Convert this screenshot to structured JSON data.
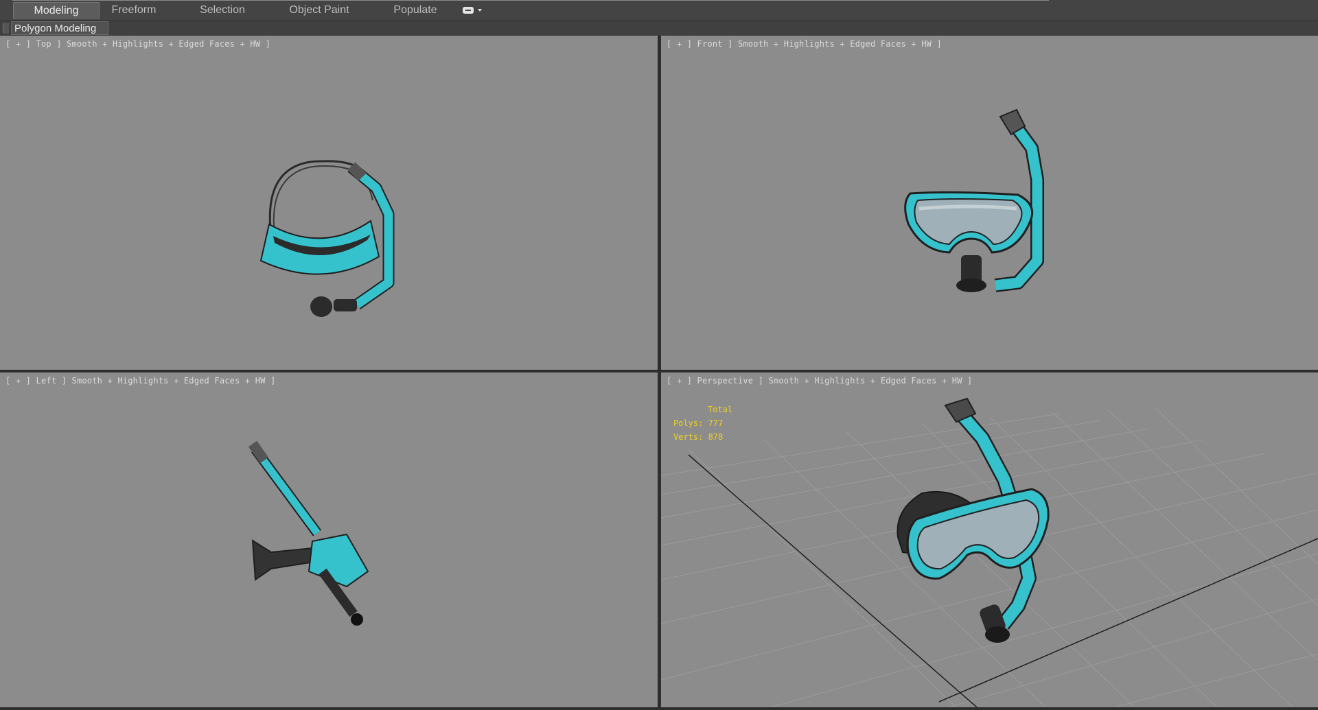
{
  "ribbon": {
    "tabs": [
      {
        "label": "Modeling",
        "active": true
      },
      {
        "label": "Freeform",
        "active": false
      },
      {
        "label": "Selection",
        "active": false
      },
      {
        "label": "Object Paint",
        "active": false
      },
      {
        "label": "Populate",
        "active": false
      }
    ],
    "panel_label": "Polygon Modeling"
  },
  "viewports": {
    "top": {
      "label": "[ + ] Top ] Smooth + Highlights + Edged Faces + HW ]"
    },
    "front": {
      "label": "[ + ] Front ] Smooth + Highlights + Edged Faces + HW ]"
    },
    "left": {
      "label": "[ + ] Left ] Smooth + Highlights + Edged Faces + HW ]"
    },
    "perspective": {
      "label": "[ + ] Perspective ] Smooth + Highlights + Edged Faces + HW ]",
      "stats": {
        "total_label": "Total",
        "polys": "Polys: 777",
        "verts": "Verts: 878"
      }
    }
  },
  "colors": {
    "viewport_bg": "#8c8c8c",
    "model_accent": "#2ec7d1",
    "model_dark": "#2b2b2b",
    "stats_text": "#f2d21f"
  }
}
